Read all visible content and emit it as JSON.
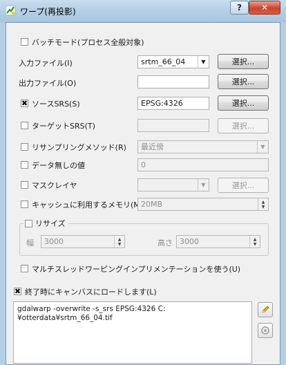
{
  "window": {
    "title": "ワープ(再投影)",
    "help_label": "?",
    "close_label": "✕"
  },
  "batch_mode": {
    "label": "バッチモード(プロセス全般対象)",
    "checked": false
  },
  "input_file": {
    "label": "入力ファイル(I)",
    "value": "srtm_66_04",
    "browse": "選択..."
  },
  "output_file": {
    "label": "出力ファイル(O)",
    "value": "",
    "browse": "選択..."
  },
  "source_srs": {
    "label": "ソースSRS(S)",
    "checked": true,
    "value": "EPSG:4326",
    "browse": "選択..."
  },
  "target_srs": {
    "label": "ターゲットSRS(T)",
    "checked": false,
    "value": "",
    "browse": "選択..."
  },
  "resampling": {
    "label": "リサンプリングメソッド(R)",
    "checked": false,
    "value": "最近傍"
  },
  "nodata": {
    "label": "データ無しの値",
    "checked": false,
    "value": "0"
  },
  "mask_layer": {
    "label": "マスクレイヤ",
    "checked": false,
    "value": "",
    "browse": "選択..."
  },
  "cache_memory": {
    "label": "キャッシュに利用するメモリ(M)",
    "checked": false,
    "value": "20MB"
  },
  "resize": {
    "label": "リサイズ",
    "checked": false,
    "width_label": "幅",
    "width_value": "3000",
    "height_label": "高さ",
    "height_value": "3000"
  },
  "multithread": {
    "label": "マルチスレッドワーピングインプリメンテーションを使う(U)",
    "checked": false
  },
  "load_into_canvas": {
    "label": "終了時にキャンバスにロードします(L)",
    "checked": true
  },
  "command": {
    "text": "gdalwarp -overwrite -s_srs EPSG:4326 C:\n¥otterdata¥srtm_66_04.tif"
  },
  "icons": {
    "title": "qgis-icon",
    "edit": "pencil-icon",
    "reset": "reset-icon"
  },
  "colors": {
    "frame": "#b3cfe5",
    "panel": "#f0f0f0",
    "close": "#c6442a"
  }
}
